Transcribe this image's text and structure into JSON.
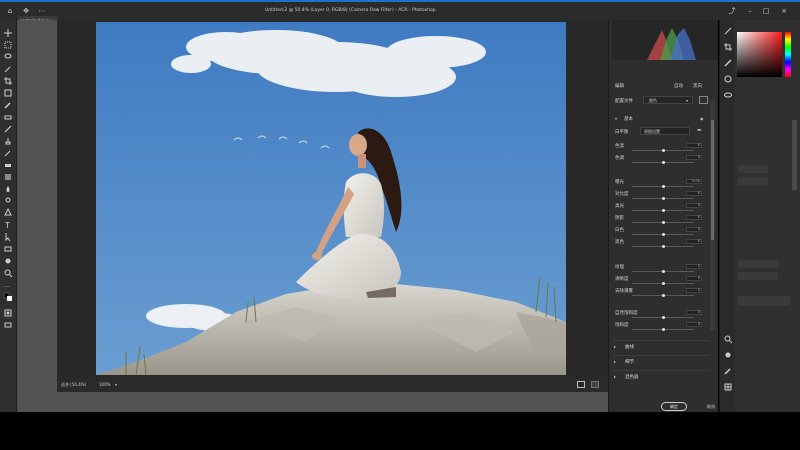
{
  "window": {
    "title": "Untitled-2 @ 50.4% (Layer 0, RGB/8) (Camera Raw Filter) - ACR - Photoshop"
  },
  "document_tab": {
    "label": "portrait of beau"
  },
  "statusbar": {
    "zoom_label": "适合 (50.4%)",
    "zoom_value": "100%",
    "dropdown_icon": "chevron-down-icon"
  },
  "acr": {
    "header": {
      "edit_label": "编辑",
      "auto_label": "自动",
      "bw_label": "黑白"
    },
    "profile": {
      "label": "配置文件",
      "value": "颜色"
    },
    "basic": {
      "title": "基本",
      "white_balance_label": "白平衡",
      "white_balance_value": "原照设置",
      "sliders": [
        {
          "label": "色温",
          "value": "0",
          "pos": 0.5
        },
        {
          "label": "色调",
          "value": "0",
          "pos": 0.5
        },
        {
          "label": "曝光",
          "value": "0.00",
          "pos": 0.5
        },
        {
          "label": "对比度",
          "value": "0",
          "pos": 0.5
        },
        {
          "label": "高光",
          "value": "0",
          "pos": 0.5
        },
        {
          "label": "阴影",
          "value": "0",
          "pos": 0.5
        },
        {
          "label": "白色",
          "value": "0",
          "pos": 0.5
        },
        {
          "label": "黑色",
          "value": "0",
          "pos": 0.5
        },
        {
          "label": "纹理",
          "value": "0",
          "pos": 0.5
        },
        {
          "label": "清晰度",
          "value": "0",
          "pos": 0.5
        },
        {
          "label": "去除薄雾",
          "value": "0",
          "pos": 0.5
        },
        {
          "label": "自然饱和度",
          "value": "0",
          "pos": 0.5
        },
        {
          "label": "饱和度",
          "value": "0",
          "pos": 0.5
        }
      ]
    },
    "sections": [
      {
        "label": "曲线"
      },
      {
        "label": "细节"
      },
      {
        "label": "混色器"
      }
    ],
    "buttons": {
      "ok": "确定",
      "cancel": "取消"
    }
  },
  "colors": {
    "accent": "#1f6fd1",
    "panel_bg": "#2e2e2e",
    "workspace_bg": "#535353",
    "sky": "#4f86c7"
  }
}
